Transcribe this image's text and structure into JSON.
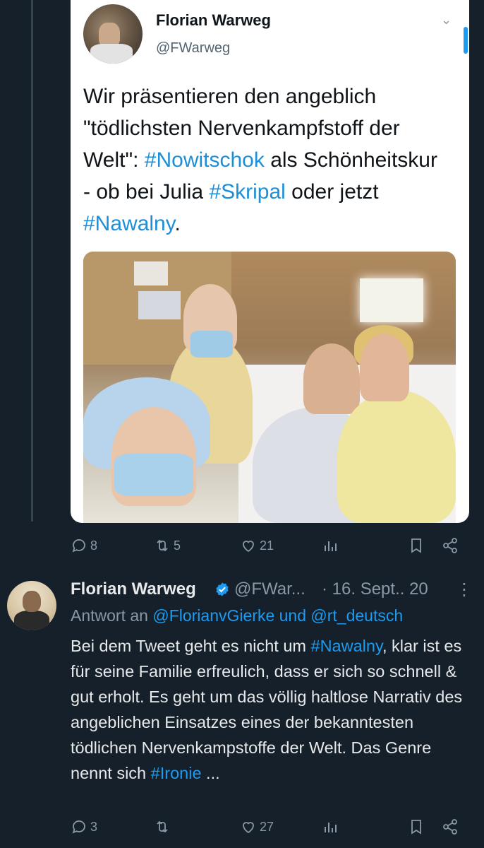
{
  "quoted_tweet": {
    "author_name": "Florian Warweg",
    "author_handle": "@FWarweg",
    "text_parts": [
      {
        "t": "Wir präsentieren den angeblich \"tödlichsten Nervenkampfstoff der Welt\": ",
        "tag": false
      },
      {
        "t": "#Nowitschok",
        "tag": true
      },
      {
        "t": " als Schönheitskur - ob bei Julia ",
        "tag": false
      },
      {
        "t": "#Skripal",
        "tag": true
      },
      {
        "t": " oder jetzt ",
        "tag": false
      },
      {
        "t": "#Nawalny",
        "tag": true
      },
      {
        "t": ".",
        "tag": false
      }
    ]
  },
  "first_actions": {
    "replies": "8",
    "retweets": "5",
    "likes": "21"
  },
  "reply_tweet": {
    "author_name": "Florian Warweg",
    "author_handle": "@FWar...",
    "date": "· 16. Sept.. 20",
    "more": "⋮",
    "reply_prefix": "Antwort an ",
    "reply_mentions": "@FlorianvGierke und @rt_deutsch",
    "text_parts": [
      {
        "t": "Bei dem Tweet geht es nicht um ",
        "tag": false
      },
      {
        "t": "#Nawalny",
        "tag": true
      },
      {
        "t": ", klar ist es für seine Familie erfreulich, dass er sich so schnell & gut erholt. Es geht um das völlig haltlose Narrativ des angeblichen Einsatzes eines der bekanntesten tödlichen Nervenkampstoffe der Welt. Das Genre nennt sich ",
        "tag": false
      },
      {
        "t": "#Ironie",
        "tag": true
      },
      {
        "t": " ...",
        "tag": false
      }
    ]
  },
  "second_actions": {
    "replies": "3",
    "retweets": "",
    "likes": "27"
  },
  "colors": {
    "background": "#15202b",
    "accent": "#1d9bf0",
    "muted": "#8b98a5"
  },
  "icons": [
    "reply-icon",
    "retweet-icon",
    "like-icon",
    "views-icon",
    "bookmark-icon",
    "share-icon",
    "verified-icon",
    "chevron-down-icon"
  ]
}
